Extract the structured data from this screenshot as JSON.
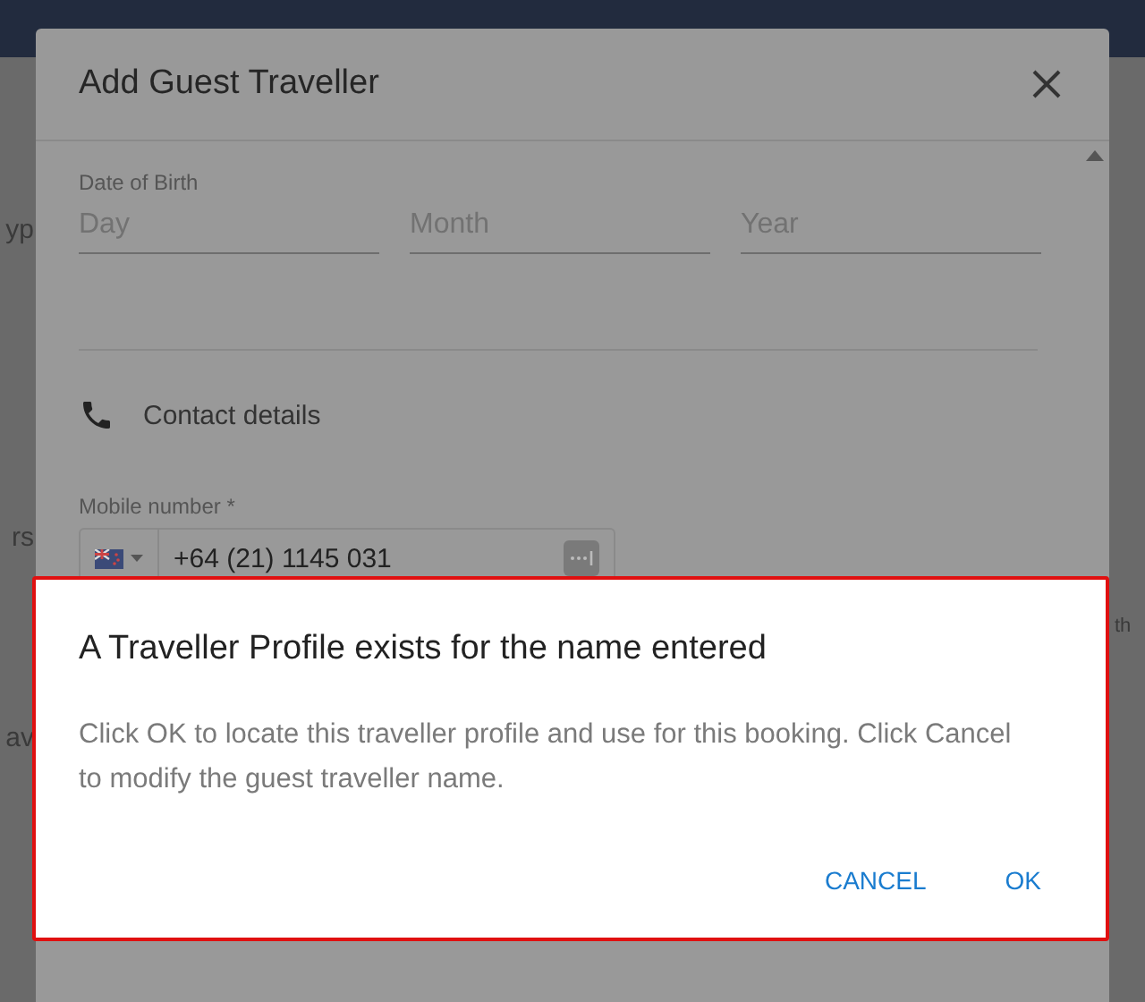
{
  "background": {
    "left_fragments": [
      "yp",
      "rs",
      "av"
    ],
    "right_fragments": [
      "th"
    ]
  },
  "dialog": {
    "title": "Add Guest Traveller",
    "date_of_birth": {
      "label": "Date of Birth",
      "fields": [
        {
          "placeholder": "Day"
        },
        {
          "placeholder": "Month"
        },
        {
          "placeholder": "Year"
        }
      ]
    },
    "contact": {
      "heading": "Contact details"
    },
    "mobile": {
      "label": "Mobile number *",
      "value": "+64 (21) 1145 031"
    }
  },
  "alert": {
    "title": "A Traveller Profile exists for the name entered",
    "message": "Click OK to locate this traveller profile and use for this booking. Click Cancel to modify the guest traveller name.",
    "buttons": [
      {
        "label": "CANCEL"
      },
      {
        "label": "OK"
      }
    ]
  }
}
